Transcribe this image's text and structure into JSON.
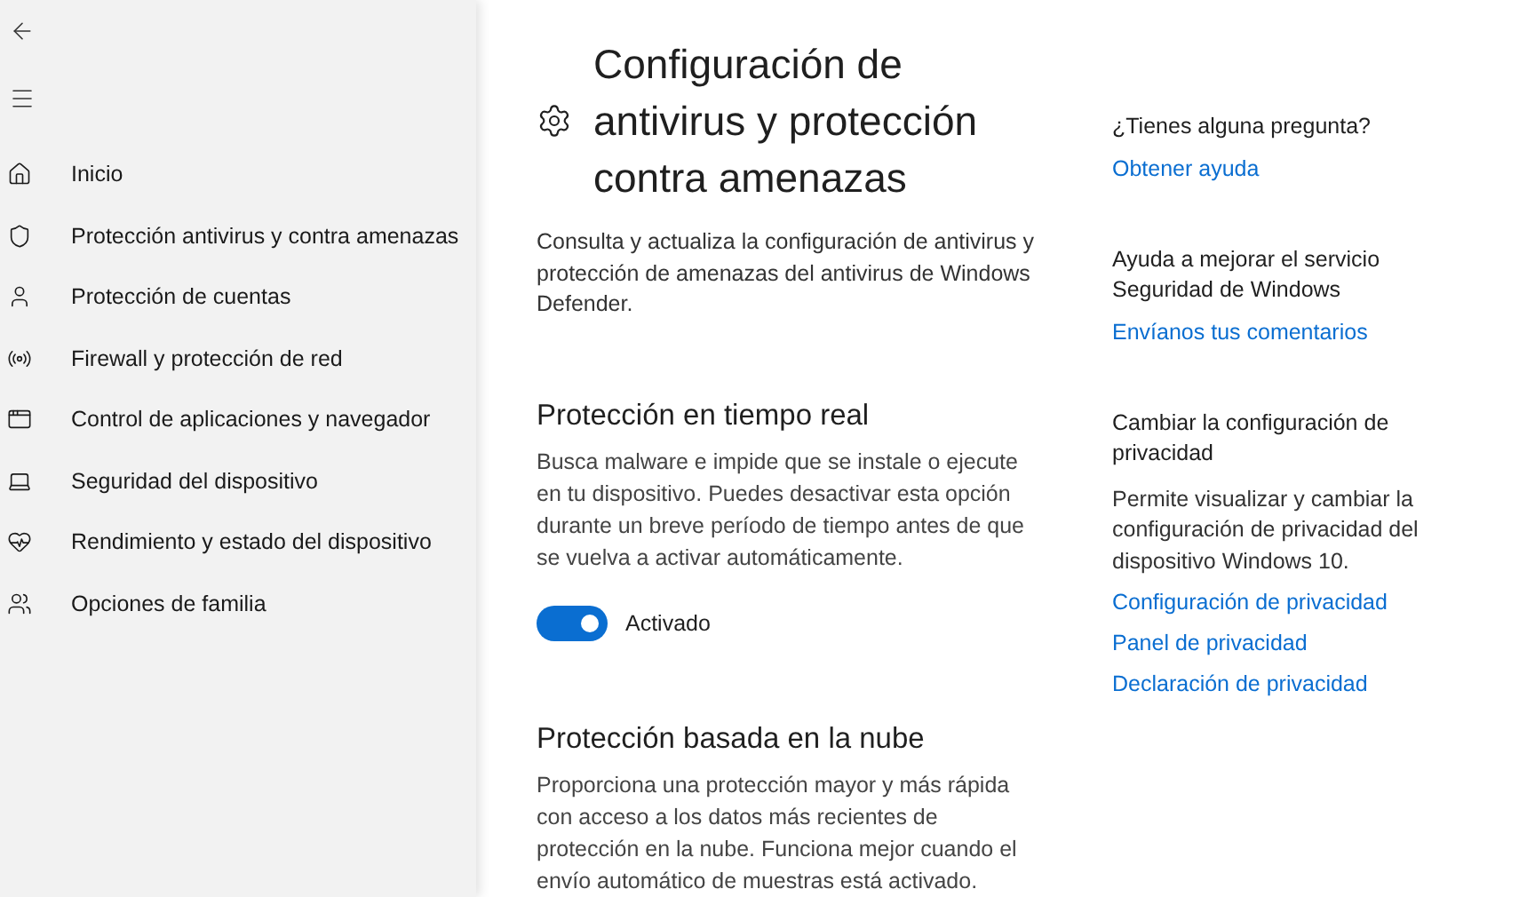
{
  "nav": {
    "items": [
      {
        "kind": "home",
        "label": "Inicio",
        "selected": false
      },
      {
        "kind": "shield",
        "label": "Protección antivirus y contra amenazas",
        "selected": false
      },
      {
        "kind": "account",
        "label": "Protección de cuentas",
        "selected": false
      },
      {
        "kind": "network",
        "label": "Firewall y protección de red",
        "selected": false
      },
      {
        "kind": "browser",
        "label": "Control de aplicaciones y navegador",
        "selected": false
      },
      {
        "kind": "device",
        "label": "Seguridad del dispositivo",
        "selected": false
      },
      {
        "kind": "health",
        "label": "Rendimiento y estado del dispositivo",
        "selected": false
      },
      {
        "kind": "family",
        "label": "Opciones de familia",
        "selected": false
      }
    ]
  },
  "page": {
    "title": "Configuración de antivirus y protección contra amenazas",
    "description": "Consulta y actualiza la configuración de antivirus y protección de amenazas del antivirus de Windows Defender.",
    "sections": [
      {
        "heading": "Protección en tiempo real",
        "text": "Busca malware e impide que se instale o ejecute en tu dispositivo. Puedes desactivar esta opción durante un breve período de tiempo antes de que se vuelva a activar automáticamente.",
        "toggle": {
          "label": "Activado",
          "on": true
        }
      },
      {
        "heading": "Protección basada en la nube",
        "text": "Proporciona una protección mayor y más rápida con acceso a los datos más recientes de protección en la nube. Funciona mejor cuando el envío automático de muestras está activado."
      }
    ]
  },
  "aside": [
    {
      "heading": "¿Tienes alguna pregunta?",
      "links": [
        "Obtener ayuda"
      ]
    },
    {
      "heading": "Ayuda a mejorar el servicio Seguridad de Windows",
      "links": [
        "Envíanos tus comentarios"
      ]
    },
    {
      "heading": "Cambiar la configuración de privacidad",
      "text": "Permite visualizar y cambiar la configuración de privacidad del dispositivo Windows 10.",
      "links": [
        "Configuración de privacidad",
        "Panel de privacidad",
        "Declaración de privacidad"
      ]
    }
  ]
}
